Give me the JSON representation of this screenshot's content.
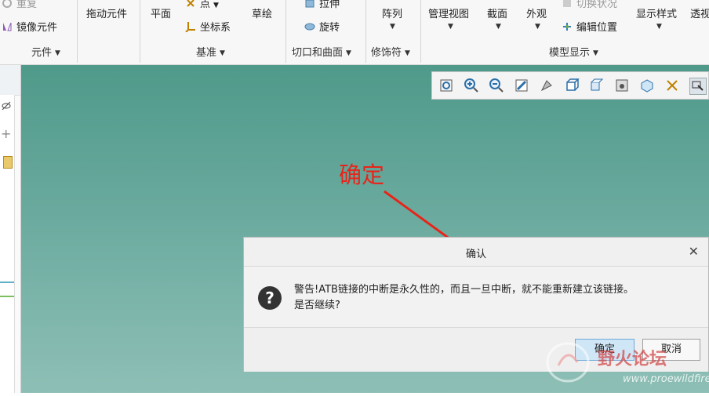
{
  "ribbon": {
    "col1": {
      "top_item": "重复",
      "item": "镜像元件"
    },
    "col2": {
      "item": "拖动元件"
    },
    "group1": "元件",
    "col3": {
      "item": "平面"
    },
    "col4": {
      "item1": "点",
      "item2": "坐标系"
    },
    "col5": {
      "item": "草绘"
    },
    "group2": "基准",
    "col6": {
      "item1": "拉伸",
      "item2": "旋转"
    },
    "group3": "切口和曲面",
    "col7": {
      "item": "阵列"
    },
    "group4": "修饰符",
    "col8": {
      "item": "管理视图"
    },
    "col9": {
      "item": "截面"
    },
    "col10": {
      "item": "外观"
    },
    "col11": {
      "item1": "切换状况",
      "item2": "编辑位置"
    },
    "col12": {
      "item": "显示样式"
    },
    "col13": {
      "item": "透视"
    },
    "group5": "模型显示"
  },
  "view_toolbar": {
    "icons": [
      "refit-icon",
      "zoom-in-icon",
      "zoom-out-icon",
      "repaint-icon",
      "spin-icon",
      "shading-icon",
      "saved-views-icon",
      "view-manager-icon",
      "datum-display-icon",
      "annotation-icon",
      "select-icon"
    ]
  },
  "annotation": {
    "text": "确定"
  },
  "dialog": {
    "title": "确认",
    "message_line1": "警告!ATB链接的中断是永久性的，而且一旦中断，就不能重新建立该链接。",
    "message_line2": "是否继续?",
    "ok_label": "确定",
    "cancel_label": "取消"
  },
  "watermark": {
    "text": "野火论坛",
    "url_text": "www.proewildfire.cn"
  },
  "colors": {
    "accent_arrow": "#e8241a",
    "graphics_top": "#4f9a8a",
    "graphics_bottom": "#8ebfb6",
    "ok_button": "#cfe6f7"
  }
}
